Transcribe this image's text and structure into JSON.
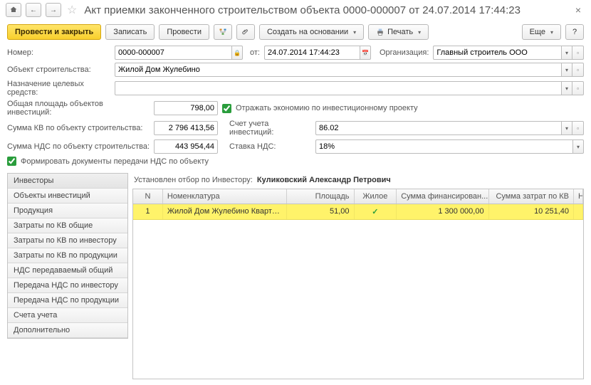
{
  "header": {
    "title": "Акт приемки законченного строительством объекта 0000-000007 от 24.07.2014 17:44:23"
  },
  "toolbar": {
    "submit": "Провести и закрыть",
    "save": "Записать",
    "process": "Провести",
    "create_based": "Создать на основании",
    "print": "Печать",
    "more": "Еще"
  },
  "form": {
    "number_lbl": "Номер:",
    "number_val": "0000-000007",
    "date_lbl": "от:",
    "date_val": "24.07.2014 17:44:23",
    "org_lbl": "Организация:",
    "org_val": "Главный строитель ООО",
    "obj_lbl": "Объект строительства:",
    "obj_val": "Жилой Дом Жулебино",
    "purpose_lbl": "Назначение целевых средств:",
    "purpose_val": "",
    "total_area_lbl": "Общая площадь объектов инвестиций:",
    "total_area_val": "798,00",
    "reflect_lbl": "Отражать экономию по инвестиционному проекту",
    "sum_kv_lbl": "Сумма КВ по объекту строительства:",
    "sum_kv_val": "2 796 413,56",
    "acct_lbl": "Счет учета инвестиций:",
    "acct_val": "86.02",
    "sum_vat_lbl": "Сумма НДС по объекту строительства:",
    "sum_vat_val": "443 954,44",
    "vat_rate_lbl": "Ставка НДС:",
    "vat_rate_val": "18%",
    "form_docs_lbl": "Формировать документы передачи НДС по объекту"
  },
  "sidebar": {
    "items": [
      "Инвесторы",
      "Объекты инвестиций",
      "Продукция",
      "Затраты по КВ общие",
      "Затраты по КВ по инвестору",
      "Затраты по КВ по продукции",
      "НДС передаваемый общий",
      "Передача НДС по инвестору",
      "Передача НДС по продукции",
      "Счета учета",
      "Дополнительно"
    ]
  },
  "filter": {
    "label": "Установлен отбор по Инвестору:",
    "value": "Куликовский Александр Петрович"
  },
  "grid": {
    "headers": {
      "n": "N",
      "nom": "Номенклатура",
      "area": "Площадь",
      "live": "Жилое",
      "fin": "Сумма финансирован...",
      "cost": "Сумма затрат по КВ",
      "vat": "НДС перед"
    },
    "rows": [
      {
        "n": "1",
        "nom": "Жилой Дом Жулебино Кварти...",
        "area": "51,00",
        "live": "✓",
        "fin": "1 300 000,00",
        "cost": "10 251,40",
        "vat": ""
      }
    ]
  }
}
